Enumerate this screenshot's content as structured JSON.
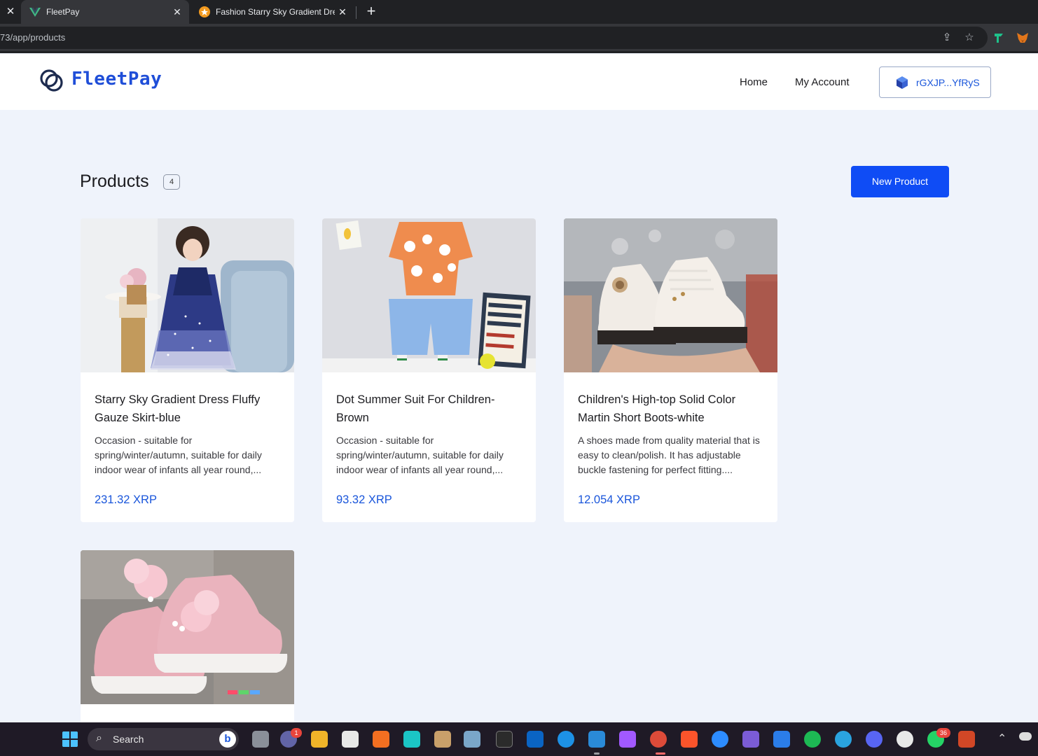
{
  "browser": {
    "tabs": [
      {
        "title": "FleetPay",
        "active": true
      },
      {
        "title": "Fashion Starry Sky Gradient Dress",
        "active": false
      }
    ],
    "url": "73/app/products"
  },
  "header": {
    "brand": "FleetPay",
    "nav": {
      "home": "Home",
      "account": "My Account"
    },
    "wallet": "rGXJP...YfRyS"
  },
  "main": {
    "title": "Products",
    "count": "4",
    "new_product_label": "New Product",
    "products": [
      {
        "name": "Starry Sky Gradient Dress Fluffy Gauze Skirt-blue",
        "description": "Occasion - suitable for spring/winter/autumn, suitable for daily indoor wear of infants all year round,...",
        "price": "231.32 XRP"
      },
      {
        "name": "Dot Summer Suit For Children- Brown",
        "description": "Occasion - suitable for spring/winter/autumn, suitable for daily indoor wear of infants all year round,...",
        "price": "93.32 XRP"
      },
      {
        "name": "Children's High-top Solid Color Martin Short Boots-white",
        "description": "A shoes made from quality material that is easy to clean/polish. It has adjustable buckle fastening for perfect fitting....",
        "price": "12.054 XRP"
      },
      {
        "name": "",
        "description": "",
        "price": ""
      }
    ]
  },
  "taskbar": {
    "search_label": "Search",
    "badges": {
      "teams": "1",
      "whatsapp": "36"
    }
  },
  "colors": {
    "primary": "#0f4cf5",
    "price": "#1a56db",
    "page_bg": "#eff3fb"
  }
}
